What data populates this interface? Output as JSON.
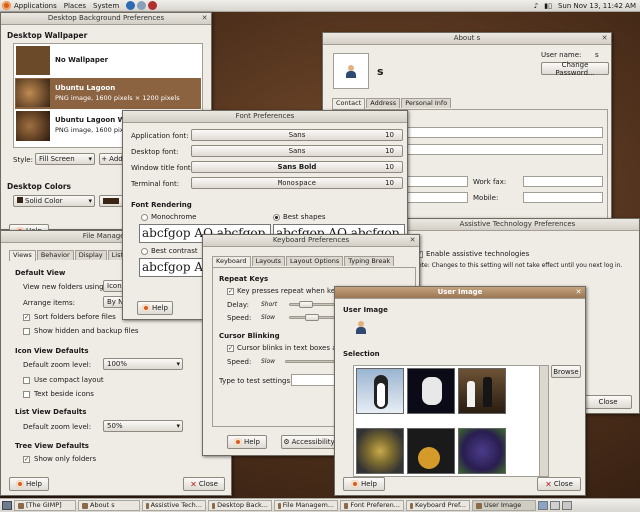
{
  "top_panel": {
    "menus": [
      "Applications",
      "Places",
      "System"
    ],
    "clock": "Sun Nov 13, 11:42 AM"
  },
  "bottom_panel": {
    "tasks": [
      {
        "label": "[The GIMP]",
        "active": false
      },
      {
        "label": "About s",
        "active": false
      },
      {
        "label": "Assistive Tech...",
        "active": false
      },
      {
        "label": "Desktop Back...",
        "active": false
      },
      {
        "label": "File Managem...",
        "active": false
      },
      {
        "label": "Font Preferen...",
        "active": false
      },
      {
        "label": "Keyboard Pref...",
        "active": false
      },
      {
        "label": "User Image",
        "active": true
      }
    ]
  },
  "bg_prefs": {
    "title": "Desktop Background Preferences",
    "section_wallpaper": "Desktop Wallpaper",
    "items": [
      {
        "name": "No Wallpaper",
        "detail": ""
      },
      {
        "name": "Ubuntu Lagoon",
        "detail": "PNG image, 1600 pixels × 1200 pixels"
      },
      {
        "name": "Ubuntu Lagoon Widescreen",
        "detail": "PNG image, 1600 pixels × 1000 pixels"
      }
    ],
    "style_label": "Style:",
    "style_value": "Fill Screen",
    "add_label": "Add",
    "section_colors": "Desktop Colors",
    "color_value": "Solid Color",
    "help": "Help"
  },
  "about": {
    "title": "About s",
    "username": "s",
    "username_label": "User name:",
    "username_value": "s",
    "change_password": "Change Password...",
    "tabs": [
      "Contact",
      "Address",
      "Personal Info"
    ],
    "work_fax": "Work fax:",
    "mobile": "Mobile:"
  },
  "font_prefs": {
    "title": "Font Preferences",
    "rows": [
      {
        "label": "Application font:",
        "font": "Sans",
        "size": "10"
      },
      {
        "label": "Desktop font:",
        "font": "Sans",
        "size": "10"
      },
      {
        "label": "Window title font:",
        "font": "Sans Bold",
        "size": "10"
      },
      {
        "label": "Terminal font:",
        "font": "Monospace",
        "size": "10"
      }
    ],
    "section_rendering": "Font Rendering",
    "monochrome": "Monochrome",
    "best_shapes": "Best shapes",
    "best_contrast": "Best contrast",
    "sample": "abcfgop AO abcfgop",
    "help": "Help"
  },
  "assistive": {
    "title": "Assistive Technology Preferences",
    "enable_label": "Enable assistive technologies",
    "note": "ote: Changes to this setting will not take effect until you next log in.",
    "close": "Close"
  },
  "file_mgmt": {
    "title": "File Management P",
    "tabs": [
      "Views",
      "Behavior",
      "Display",
      "List Colu"
    ],
    "section_default_view": "Default View",
    "view_new_label": "View new folders using:",
    "view_new_value": "Icon",
    "arrange_label": "Arrange items:",
    "arrange_value": "By N",
    "sort_folders": "Sort folders before files",
    "show_hidden": "Show hidden and backup files",
    "section_icon_defaults": "Icon View Defaults",
    "icon_zoom_label": "Default zoom level:",
    "icon_zoom_value": "100%",
    "compact_layout": "Use compact layout",
    "text_beside": "Text beside icons",
    "section_list_defaults": "List View Defaults",
    "list_zoom_label": "Default zoom level:",
    "list_zoom_value": "50%",
    "section_tree_defaults": "Tree View Defaults",
    "show_only_folders": "Show only folders",
    "help": "Help",
    "close": "Close"
  },
  "keyboard": {
    "title": "Keyboard Preferences",
    "tabs": [
      "Keyboard",
      "Layouts",
      "Layout Options",
      "Typing Break"
    ],
    "section_repeat": "Repeat Keys",
    "repeat_check": "Key presses repeat when key",
    "delay_label": "Delay:",
    "speed_label": "Speed:",
    "short": "Short",
    "slow": "Slow",
    "section_cursor": "Cursor Blinking",
    "cursor_check": "Cursor blinks in text boxes and",
    "cursor_speed_label": "Speed:",
    "cursor_slow": "Slow",
    "test_label": "Type to test settings:",
    "help": "Help",
    "accessibility": "Accessibility"
  },
  "user_image": {
    "title": "User Image",
    "section_image": "User Image",
    "section_selection": "Selection",
    "browse": "Browse",
    "help": "Help",
    "close": "Close"
  }
}
